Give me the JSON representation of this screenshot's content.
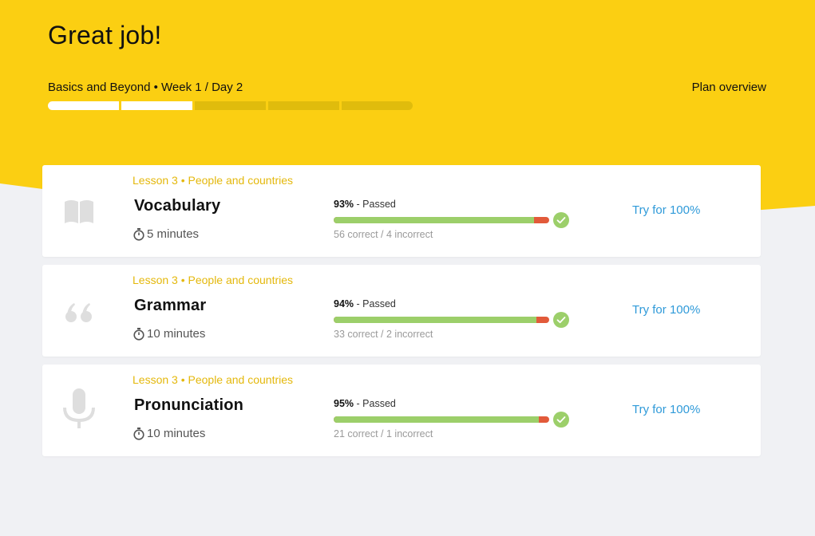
{
  "header": {
    "title": "Great job!",
    "course_line": "Basics and Beyond • Week 1 / Day 2",
    "plan_link": "Plan overview",
    "bg_color": "#fbcf12",
    "week_progress": {
      "total_days": 5,
      "completed_days": 2
    }
  },
  "colors": {
    "page_bg": "#f0f1f4",
    "accent_text": "#e4b80c",
    "link": "#2f9ad9",
    "passed_bar": "#9ccf6a",
    "failed_bar": "#e25a3a",
    "check": "#9ccf6a"
  },
  "results": [
    {
      "icon": "book-icon",
      "lesson": "Lesson 3 • People and countries",
      "title": "Vocabulary",
      "duration": "5 minutes",
      "score": "93%",
      "status": "- Passed",
      "pass_fraction": 0.93,
      "counts": "56 correct / 4 incorrect",
      "action": "Try for 100%"
    },
    {
      "icon": "quote-icon",
      "lesson": "Lesson 3 • People and countries",
      "title": "Grammar",
      "duration": "10 minutes",
      "score": "94%",
      "status": "- Passed",
      "pass_fraction": 0.94,
      "counts": "33 correct / 2 incorrect",
      "action": "Try for 100%"
    },
    {
      "icon": "microphone-icon",
      "lesson": "Lesson 3 • People and countries",
      "title": "Pronunciation",
      "duration": "10 minutes",
      "score": "95%",
      "status": "- Passed",
      "pass_fraction": 0.95,
      "counts": "21 correct / 1 incorrect",
      "action": "Try for 100%"
    }
  ]
}
